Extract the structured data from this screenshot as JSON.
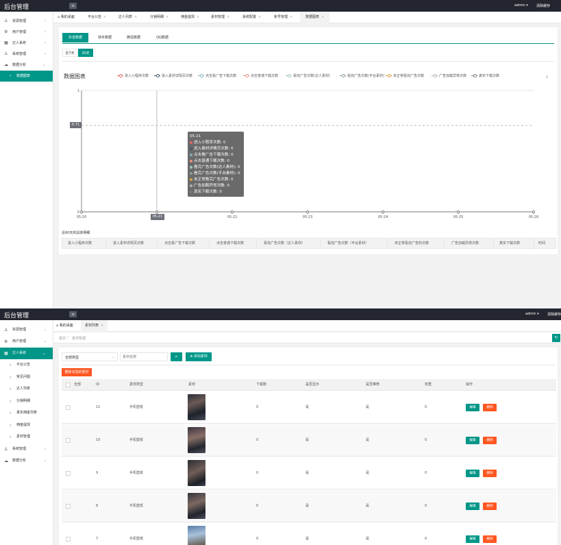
{
  "app": {
    "title": "后台管理",
    "user": "admin",
    "clear_cache": "清除缓存"
  },
  "w1": {
    "sidebar": [
      {
        "label": "资源管理",
        "icon": "user-icon",
        "chev": "‹"
      },
      {
        "label": "用户管理",
        "icon": "settings-icon",
        "chev": "‹"
      },
      {
        "label": "达人系统",
        "icon": "grid-icon",
        "chev": "‹"
      },
      {
        "label": "系统管理",
        "icon": "user-icon",
        "chev": "‹"
      },
      {
        "label": "数据分析",
        "icon": "cloud-icon",
        "chev": "⌄"
      },
      {
        "label": "数据图表",
        "icon": "",
        "chev": ""
      }
    ],
    "tabs": [
      "我的桌面",
      "平台公告",
      "达人列表",
      "分销明细",
      "佣金提现",
      "素材管理",
      "系统配置",
      "账号管理",
      "数据图表"
    ],
    "subtabs": [
      "抖音数据",
      "快手数据",
      "微信数据",
      "QQ数据"
    ],
    "range": [
      "近7天",
      "30天"
    ],
    "chart_title": "数据图表",
    "tooltip": {
      "title": "05-21",
      "lines": [
        "进入小程序次数: 0",
        "进入素材详情页次数: 0",
        "点击看广告下载次数: 0",
        "点击普通下载次数: 0",
        "看完广告次数(达人素材): 0",
        "看完广告次数(平台素材): 0",
        "未正常看完广告次数: 0",
        "广告加载异常次数: 0",
        "真实下载次数: 0"
      ]
    },
    "marker_label": "0.71",
    "cursor_x_label": "05-21",
    "detail_title": "近60天的具体明细",
    "detail_headers": [
      "进入小程序次数",
      "进入素材详情页次数",
      "点击看广告下载次数",
      "点击普通下载次数",
      "看完广告次数（达人素材）",
      "看完广告次数（平台素材）",
      "未正常看完广告的次数",
      "广告加载异常次数",
      "真实下载次数",
      "时间"
    ]
  },
  "chart_data": {
    "type": "line",
    "title": "数据图表",
    "x": [
      "05-20",
      "05-21",
      "05-22",
      "05-23",
      "05-24",
      "05-25",
      "05-26"
    ],
    "ylim": [
      0,
      1
    ],
    "yticks": [
      "0",
      "1"
    ],
    "series": [
      {
        "name": "进入小程序次数",
        "color": "#e06666",
        "values": [
          0,
          0,
          0,
          0,
          0,
          0,
          0
        ]
      },
      {
        "name": "进入素材详情页次数",
        "color": "#4a5a6a",
        "values": [
          0,
          0,
          0,
          0,
          0,
          0,
          0
        ]
      },
      {
        "name": "点击看广告下载次数",
        "color": "#82b1b5",
        "values": [
          0,
          0,
          0,
          0,
          0,
          0,
          0
        ]
      },
      {
        "name": "点击普通下载次数",
        "color": "#e89080",
        "values": [
          0,
          0,
          0,
          0,
          0,
          0,
          0
        ]
      },
      {
        "name": "看完广告次数(达人素材)",
        "color": "#9cc8b8",
        "values": [
          0,
          0,
          0,
          0,
          0,
          0,
          0
        ]
      },
      {
        "name": "看完广告次数(平台素材)",
        "color": "#8aa090",
        "values": [
          0,
          0,
          0,
          0,
          0,
          0,
          0
        ]
      },
      {
        "name": "未正常看完广告次数",
        "color": "#d9a040",
        "values": [
          0,
          0,
          0,
          0,
          0,
          0,
          0
        ]
      },
      {
        "name": "广告加载异常次数",
        "color": "#b0b0b0",
        "values": [
          0,
          0,
          0,
          0,
          0,
          0,
          0
        ]
      },
      {
        "name": "真实下载次数",
        "color": "#777777",
        "values": [
          0,
          0,
          0,
          0,
          0,
          0,
          0
        ]
      }
    ]
  },
  "w2": {
    "sidebar": [
      {
        "label": "资源管理",
        "icon": "user-icon",
        "chev": "‹"
      },
      {
        "label": "用户管理",
        "icon": "settings-icon",
        "chev": "‹"
      },
      {
        "label": "达人系统",
        "icon": "grid-icon",
        "chev": "⌄"
      },
      {
        "label": "平台公告"
      },
      {
        "label": "常见问题"
      },
      {
        "label": "达人列表"
      },
      {
        "label": "分销明细"
      },
      {
        "label": "真实佣金列表"
      },
      {
        "label": "佣金提现"
      },
      {
        "label": "素材管理"
      },
      {
        "label": "系统管理",
        "icon": "user-icon",
        "chev": "‹"
      },
      {
        "label": "数据分析",
        "icon": "cloud-icon",
        "chev": "‹"
      }
    ],
    "tabs": [
      "我的桌面",
      "素材列表"
    ],
    "breadcrumb": [
      "首页",
      "素材管理"
    ],
    "filter_select": "全部类型",
    "search_placeholder": "素材名称",
    "add_button": "添加素材",
    "bulk_delete": "删除勾选的素材",
    "headers": [
      "全部",
      "ID",
      "素材类型",
      "素材",
      "下载数",
      "是否显示",
      "是否推荐",
      "权重",
      "操作"
    ],
    "rows": [
      {
        "id": "11",
        "type": "手机壁纸",
        "downloads": "0",
        "show": "是",
        "recommend": "是",
        "weight": "0"
      },
      {
        "id": "10",
        "type": "手机壁纸",
        "downloads": "0",
        "show": "是",
        "recommend": "是",
        "weight": "0"
      },
      {
        "id": "9",
        "type": "手机壁纸",
        "downloads": "0",
        "show": "是",
        "recommend": "是",
        "weight": "0"
      },
      {
        "id": "8",
        "type": "手机壁纸",
        "downloads": "0",
        "show": "是",
        "recommend": "是",
        "weight": "0"
      },
      {
        "id": "7",
        "type": "手机壁纸",
        "downloads": "0",
        "show": "是",
        "recommend": "是",
        "weight": "0"
      }
    ],
    "edit_label": "编辑",
    "delete_label": "删除"
  }
}
